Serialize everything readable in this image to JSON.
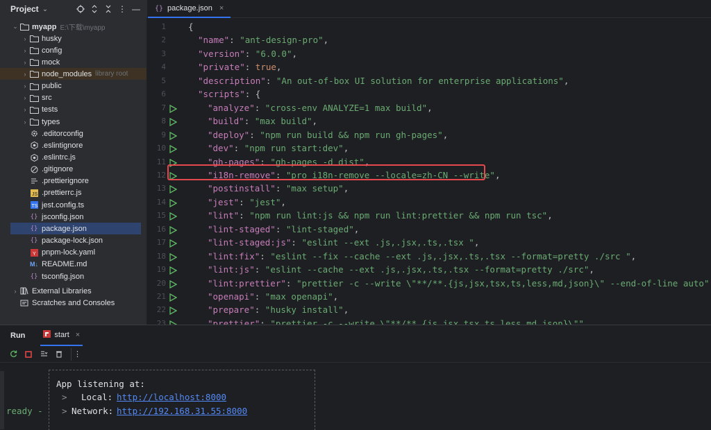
{
  "project": {
    "title": "Project",
    "root": {
      "name": "myapp",
      "path": "E:\\下载\\myapp"
    },
    "items": [
      {
        "label": "husky",
        "type": "folder"
      },
      {
        "label": "config",
        "type": "folder"
      },
      {
        "label": "mock",
        "type": "folder"
      },
      {
        "label": "node_modules",
        "type": "folder",
        "hint": "library root"
      },
      {
        "label": "public",
        "type": "folder"
      },
      {
        "label": "src",
        "type": "folder"
      },
      {
        "label": "tests",
        "type": "folder"
      },
      {
        "label": "types",
        "type": "folder"
      },
      {
        "label": ".editorconfig",
        "type": "gear"
      },
      {
        "label": ".eslintignore",
        "type": "eslint"
      },
      {
        "label": ".eslintrc.js",
        "type": "eslint"
      },
      {
        "label": ".gitignore",
        "type": "git"
      },
      {
        "label": ".prettierignore",
        "type": "lines"
      },
      {
        "label": ".prettierrc.js",
        "type": "js"
      },
      {
        "label": "jest.config.ts",
        "type": "ts"
      },
      {
        "label": "jsconfig.json",
        "type": "json"
      },
      {
        "label": "package.json",
        "type": "json"
      },
      {
        "label": "package-lock.json",
        "type": "json"
      },
      {
        "label": "pnpm-lock.yaml",
        "type": "yaml"
      },
      {
        "label": "README.md",
        "type": "md"
      },
      {
        "label": "tsconfig.json",
        "type": "json"
      }
    ],
    "external": "External Libraries",
    "scratches": "Scratches and Consoles"
  },
  "editor": {
    "tab": "package.json",
    "lines": [
      {
        "n": "1",
        "t": "{"
      },
      {
        "n": "2",
        "k": "\"name\"",
        "v": "\"ant-design-pro\"",
        "ind": 1
      },
      {
        "n": "3",
        "k": "\"version\"",
        "v": "\"6.0.0\"",
        "ind": 1
      },
      {
        "n": "4",
        "k": "\"private\"",
        "b": "true",
        "ind": 1
      },
      {
        "n": "5",
        "k": "\"description\"",
        "v": "\"An out-of-box UI solution for enterprise applications\"",
        "ind": 1
      },
      {
        "n": "6",
        "k": "\"scripts\"",
        "o": "{",
        "ind": 1
      },
      {
        "n": "7",
        "k": "\"analyze\"",
        "v": "\"cross-env ANALYZE=1 max build\"",
        "ind": 2,
        "run": true
      },
      {
        "n": "8",
        "k": "\"build\"",
        "v": "\"max build\"",
        "ind": 2,
        "run": true
      },
      {
        "n": "9",
        "k": "\"deploy\"",
        "v": "\"npm run build && npm run gh-pages\"",
        "ind": 2,
        "run": true
      },
      {
        "n": "10",
        "k": "\"dev\"",
        "v": "\"npm run start:dev\"",
        "ind": 2,
        "run": true
      },
      {
        "n": "11",
        "k": "\"gh-pages\"",
        "v": "\"gh-pages -d dist\"",
        "ind": 2,
        "run": true
      },
      {
        "n": "12",
        "k": "\"i18n-remove\"",
        "v": "\"pro i18n-remove --locale=zh-CN --write\"",
        "ind": 2,
        "run": true
      },
      {
        "n": "13",
        "k": "\"postinstall\"",
        "v": "\"max setup\"",
        "ind": 2,
        "run": true
      },
      {
        "n": "14",
        "k": "\"jest\"",
        "v": "\"jest\"",
        "ind": 2,
        "run": true
      },
      {
        "n": "15",
        "k": "\"lint\"",
        "v": "\"npm run lint:js && npm run lint:prettier && npm run tsc\"",
        "ind": 2,
        "run": true
      },
      {
        "n": "16",
        "k": "\"lint-staged\"",
        "v": "\"lint-staged\"",
        "ind": 2,
        "run": true
      },
      {
        "n": "17",
        "k": "\"lint-staged:js\"",
        "v": "\"eslint --ext .js,.jsx,.ts,.tsx \"",
        "ind": 2,
        "run": true
      },
      {
        "n": "18",
        "k": "\"lint:fix\"",
        "v": "\"eslint --fix --cache --ext .js,.jsx,.ts,.tsx --format=pretty ./src \"",
        "ind": 2,
        "run": true
      },
      {
        "n": "19",
        "k": "\"lint:js\"",
        "v": "\"eslint --cache --ext .js,.jsx,.ts,.tsx --format=pretty ./src\"",
        "ind": 2,
        "run": true
      },
      {
        "n": "20",
        "k": "\"lint:prettier\"",
        "v": "\"prettier -c --write \\\"**/**.{js,jsx,tsx,ts,less,md,json}\\\" --end-of-line auto\"",
        "ind": 2,
        "run": true
      },
      {
        "n": "21",
        "k": "\"openapi\"",
        "v": "\"max openapi\"",
        "ind": 2,
        "run": true
      },
      {
        "n": "22",
        "k": "\"prepare\"",
        "v": "\"husky install\"",
        "ind": 2,
        "run": true
      },
      {
        "n": "23",
        "k": "\"prettier\"",
        "v": "\"prettier -c --write \\\"**/**.{js,jsx,tsx,ts,less,md,json}\\\"\"",
        "ind": 2,
        "run": true
      }
    ]
  },
  "run": {
    "title": "Run",
    "tab": "start",
    "console": {
      "heading": "App listening at:",
      "local_label": "Local:",
      "local_url": "http://localhost:8000",
      "network_label": "Network:",
      "network_url": "http://192.168.31.55:8000",
      "ready": "ready -"
    }
  },
  "colors": {
    "accent": "#3574f0",
    "highlight_box": "#e5484d",
    "selected": "#2e436e"
  }
}
